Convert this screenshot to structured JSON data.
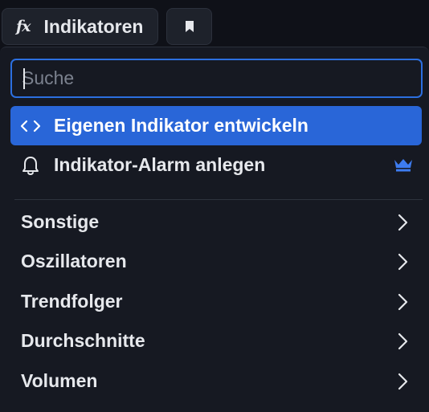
{
  "toolbar": {
    "indicators_icon_text": "fx",
    "indicators_label": "Indikatoren",
    "bookmark_icon": "bookmark-icon"
  },
  "search": {
    "placeholder": "Suche",
    "value": ""
  },
  "actions": [
    {
      "label": "Eigenen Indikator entwickeln",
      "icon": "code-icon",
      "active": true
    },
    {
      "label": "Indikator-Alarm anlegen",
      "icon": "bell-icon",
      "badge_icon": "crown-icon",
      "active": false
    }
  ],
  "categories": [
    {
      "label": "Sonstige"
    },
    {
      "label": "Oszillatoren"
    },
    {
      "label": "Trendfolger"
    },
    {
      "label": "Durchschnitte"
    },
    {
      "label": "Volumen"
    }
  ],
  "colors": {
    "accent": "#2966d8",
    "focus_border": "#2c6fe0",
    "panel_bg": "#161922",
    "text": "#e6e8ec",
    "crown": "#3d7cf0"
  }
}
